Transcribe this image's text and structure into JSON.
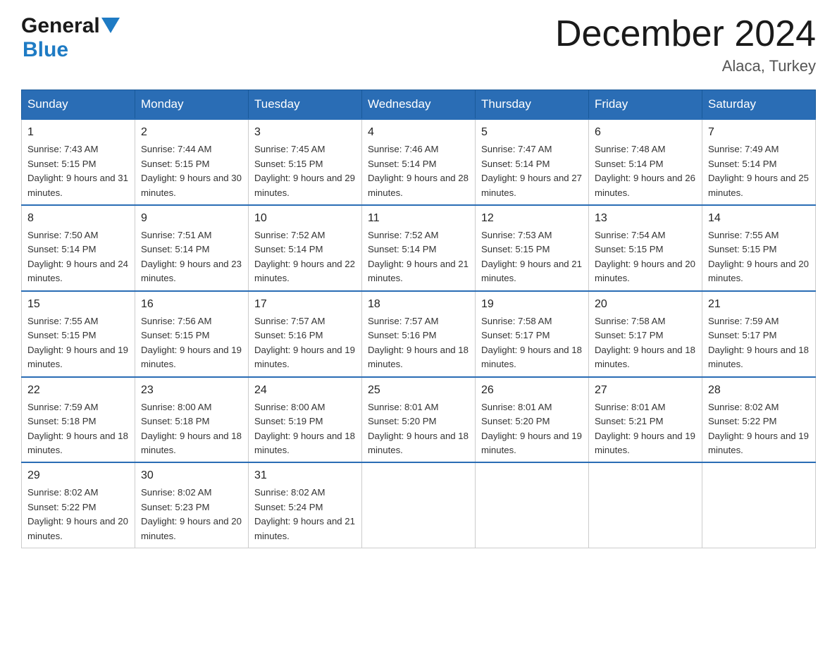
{
  "header": {
    "logo_general": "General",
    "logo_blue": "Blue",
    "month_title": "December 2024",
    "location": "Alaca, Turkey"
  },
  "days_of_week": [
    "Sunday",
    "Monday",
    "Tuesday",
    "Wednesday",
    "Thursday",
    "Friday",
    "Saturday"
  ],
  "weeks": [
    [
      {
        "day": "1",
        "sunrise": "7:43 AM",
        "sunset": "5:15 PM",
        "daylight": "9 hours and 31 minutes."
      },
      {
        "day": "2",
        "sunrise": "7:44 AM",
        "sunset": "5:15 PM",
        "daylight": "9 hours and 30 minutes."
      },
      {
        "day": "3",
        "sunrise": "7:45 AM",
        "sunset": "5:15 PM",
        "daylight": "9 hours and 29 minutes."
      },
      {
        "day": "4",
        "sunrise": "7:46 AM",
        "sunset": "5:14 PM",
        "daylight": "9 hours and 28 minutes."
      },
      {
        "day": "5",
        "sunrise": "7:47 AM",
        "sunset": "5:14 PM",
        "daylight": "9 hours and 27 minutes."
      },
      {
        "day": "6",
        "sunrise": "7:48 AM",
        "sunset": "5:14 PM",
        "daylight": "9 hours and 26 minutes."
      },
      {
        "day": "7",
        "sunrise": "7:49 AM",
        "sunset": "5:14 PM",
        "daylight": "9 hours and 25 minutes."
      }
    ],
    [
      {
        "day": "8",
        "sunrise": "7:50 AM",
        "sunset": "5:14 PM",
        "daylight": "9 hours and 24 minutes."
      },
      {
        "day": "9",
        "sunrise": "7:51 AM",
        "sunset": "5:14 PM",
        "daylight": "9 hours and 23 minutes."
      },
      {
        "day": "10",
        "sunrise": "7:52 AM",
        "sunset": "5:14 PM",
        "daylight": "9 hours and 22 minutes."
      },
      {
        "day": "11",
        "sunrise": "7:52 AM",
        "sunset": "5:14 PM",
        "daylight": "9 hours and 21 minutes."
      },
      {
        "day": "12",
        "sunrise": "7:53 AM",
        "sunset": "5:15 PM",
        "daylight": "9 hours and 21 minutes."
      },
      {
        "day": "13",
        "sunrise": "7:54 AM",
        "sunset": "5:15 PM",
        "daylight": "9 hours and 20 minutes."
      },
      {
        "day": "14",
        "sunrise": "7:55 AM",
        "sunset": "5:15 PM",
        "daylight": "9 hours and 20 minutes."
      }
    ],
    [
      {
        "day": "15",
        "sunrise": "7:55 AM",
        "sunset": "5:15 PM",
        "daylight": "9 hours and 19 minutes."
      },
      {
        "day": "16",
        "sunrise": "7:56 AM",
        "sunset": "5:15 PM",
        "daylight": "9 hours and 19 minutes."
      },
      {
        "day": "17",
        "sunrise": "7:57 AM",
        "sunset": "5:16 PM",
        "daylight": "9 hours and 19 minutes."
      },
      {
        "day": "18",
        "sunrise": "7:57 AM",
        "sunset": "5:16 PM",
        "daylight": "9 hours and 18 minutes."
      },
      {
        "day": "19",
        "sunrise": "7:58 AM",
        "sunset": "5:17 PM",
        "daylight": "9 hours and 18 minutes."
      },
      {
        "day": "20",
        "sunrise": "7:58 AM",
        "sunset": "5:17 PM",
        "daylight": "9 hours and 18 minutes."
      },
      {
        "day": "21",
        "sunrise": "7:59 AM",
        "sunset": "5:17 PM",
        "daylight": "9 hours and 18 minutes."
      }
    ],
    [
      {
        "day": "22",
        "sunrise": "7:59 AM",
        "sunset": "5:18 PM",
        "daylight": "9 hours and 18 minutes."
      },
      {
        "day": "23",
        "sunrise": "8:00 AM",
        "sunset": "5:18 PM",
        "daylight": "9 hours and 18 minutes."
      },
      {
        "day": "24",
        "sunrise": "8:00 AM",
        "sunset": "5:19 PM",
        "daylight": "9 hours and 18 minutes."
      },
      {
        "day": "25",
        "sunrise": "8:01 AM",
        "sunset": "5:20 PM",
        "daylight": "9 hours and 18 minutes."
      },
      {
        "day": "26",
        "sunrise": "8:01 AM",
        "sunset": "5:20 PM",
        "daylight": "9 hours and 19 minutes."
      },
      {
        "day": "27",
        "sunrise": "8:01 AM",
        "sunset": "5:21 PM",
        "daylight": "9 hours and 19 minutes."
      },
      {
        "day": "28",
        "sunrise": "8:02 AM",
        "sunset": "5:22 PM",
        "daylight": "9 hours and 19 minutes."
      }
    ],
    [
      {
        "day": "29",
        "sunrise": "8:02 AM",
        "sunset": "5:22 PM",
        "daylight": "9 hours and 20 minutes."
      },
      {
        "day": "30",
        "sunrise": "8:02 AM",
        "sunset": "5:23 PM",
        "daylight": "9 hours and 20 minutes."
      },
      {
        "day": "31",
        "sunrise": "8:02 AM",
        "sunset": "5:24 PM",
        "daylight": "9 hours and 21 minutes."
      },
      null,
      null,
      null,
      null
    ]
  ]
}
